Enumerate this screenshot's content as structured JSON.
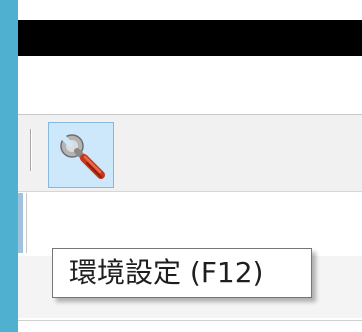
{
  "toolbar": {
    "settings_button": {
      "icon": "wrench-icon",
      "accent": "#d23a1c"
    }
  },
  "tooltip": {
    "text": "環境設定 (F12)"
  }
}
